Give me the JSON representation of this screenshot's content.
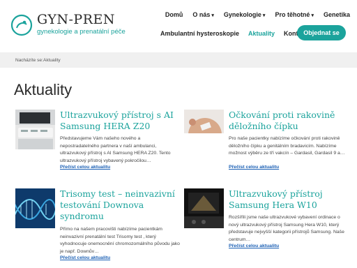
{
  "brand": {
    "name": "GYN-PREN",
    "tagline": "gynekologie a prenatální péče"
  },
  "nav": {
    "primary": [
      "Domů",
      "O nás",
      "Gynekologie",
      "Pro těhotné",
      "Genetika"
    ],
    "secondary": [
      "Ambulantní hysteroskopie",
      "Aktuality",
      "Kontakty"
    ],
    "active": "Aktuality",
    "cta_label": "Objednat se"
  },
  "breadcrumb": {
    "prefix": "Nacházíte se:",
    "current": "Aktuality"
  },
  "page": {
    "title": "Aktuality"
  },
  "articles": [
    {
      "title": "Ultrazvukový přístroj s AI Samsung HERA Z20",
      "excerpt": "Představujeme Vám našeho nového a nepostradatelného partnera v naší ambulanci, ultrazvukový přístroj s AI Samsung HERA Z20. Tento ultrazvukový přístroj vybavený pokročilou…",
      "more": "Přečíst celou aktualitu",
      "thumb": "ultrasound-machine"
    },
    {
      "title": "Očkování proti rakovině děložního čípku",
      "excerpt": "Pro naše pacientky nabízíme očkování proti rakovině děložního čípku a genitálním bradavicím. Nabízíme možnost výběru ze tří vakcín – Gardasil, Gardasil 9 a…",
      "more": "Přečíst celou aktualitu",
      "thumb": "vaccination"
    },
    {
      "title": "Trisomy test – neinvazivní testování Downova syndromu",
      "excerpt": "Přímo na našem pracovišti nabízíme pacientkám neinvazivní prenatální test Trisomy test , který vyhodnocuje onemocnění chromozomálního původu jako je např. Downův…",
      "more": "Přečíst celou aktualitu",
      "thumb": "dna-helix"
    },
    {
      "title": "Ultrazvukový přístroj Samsung Hera W10",
      "excerpt": "Rozšířili jsme naše ultrazvukové vybavení ordinace o nový ultrazvukový přístroj Samsung Hera W10, který představuje nejvyšší kategorii přístrojů Samsung. Naše centrum…",
      "more": "Přečíst celou aktualitu",
      "thumb": "ultrasound-monitor"
    }
  ],
  "colors": {
    "accent": "#1ba39c",
    "link": "#1a5fb4",
    "crumb_bg": "#f0f0f0"
  }
}
